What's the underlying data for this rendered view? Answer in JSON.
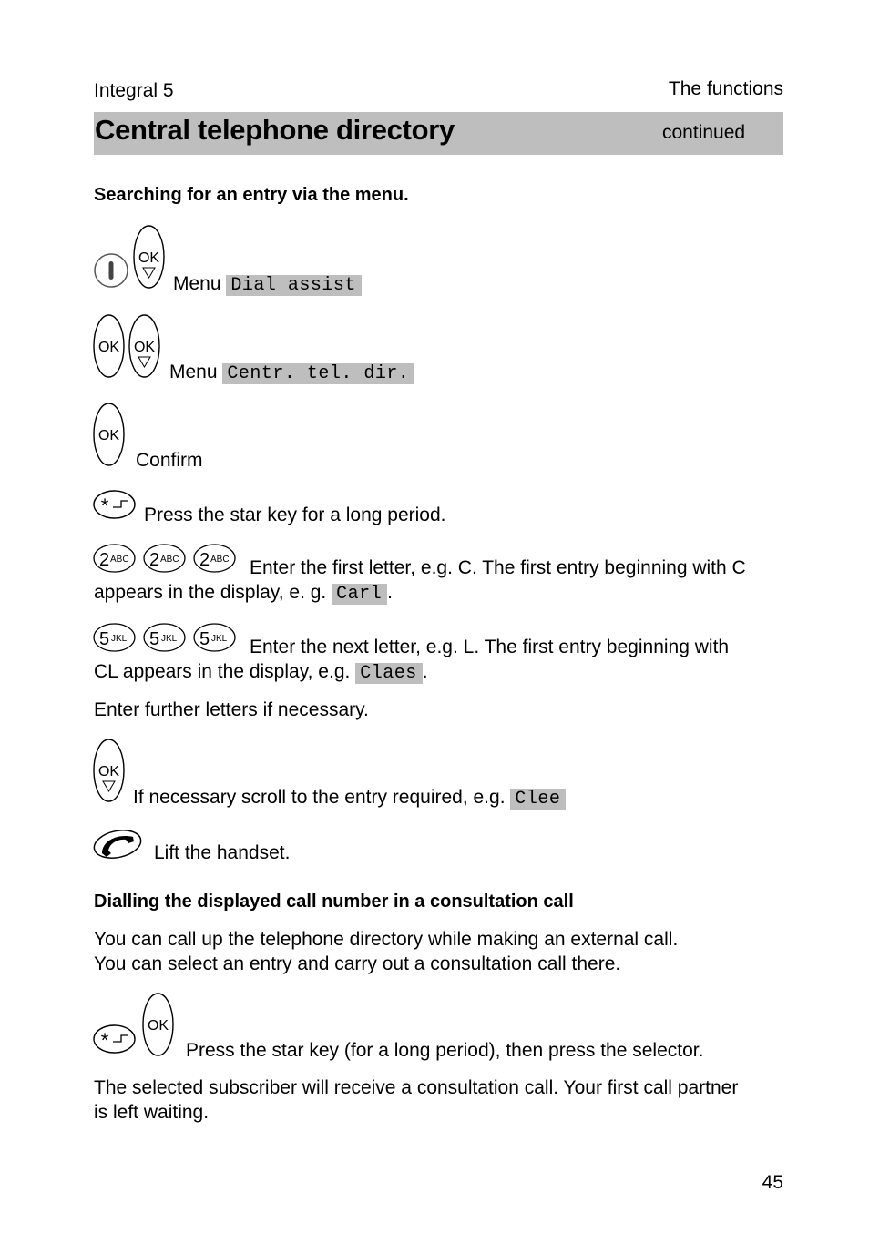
{
  "header": {
    "product": "Integral 5",
    "chapter": "The functions"
  },
  "title_bar": {
    "title": "Central telephone directory",
    "continued": "continued"
  },
  "section1": {
    "heading": "Searching for an entry via the menu.",
    "steps": [
      {
        "icons": [
          "handset-key-icon",
          "ok-scroll-key-icon"
        ],
        "text": "Menu",
        "display": "Dial assist"
      },
      {
        "icons": [
          "ok-key-icon",
          "ok-scroll-key-icon"
        ],
        "text": "Menu",
        "display": "Centr. tel. dir."
      },
      {
        "icons": [
          "ok-key-icon"
        ],
        "text": "Confirm"
      },
      {
        "icons": [
          "star-key-icon"
        ],
        "text": "Press the star key for a long period."
      },
      {
        "icons": [
          "key-2-abc-icon",
          "key-2-abc-icon",
          "key-2-abc-icon"
        ],
        "text": "Enter the first letter, e.g. C. The first entry beginning with C",
        "text2": "appears in the display, e. g.",
        "display": "Carl",
        "suffix": "."
      },
      {
        "icons": [
          "key-5-jkl-icon",
          "key-5-jkl-icon",
          "key-5-jkl-icon"
        ],
        "text": "Enter the next letter, e.g. L. The first entry beginning with",
        "text2": "CL appears in the display, e.g.",
        "display": "Claes",
        "suffix": "."
      }
    ],
    "note": "Enter further letters if necessary.",
    "steps2": [
      {
        "icons": [
          "ok-scroll-key-icon"
        ],
        "text": "If necessary scroll to the entry required, e.g.",
        "display": "Clee"
      },
      {
        "icons": [
          "handset-lift-icon"
        ],
        "text": "Lift the handset."
      }
    ]
  },
  "section2": {
    "heading": "Dialling the displayed call number in a consultation call",
    "intro_line1": "You can call up the telephone directory while making an external call.",
    "intro_line2": "You can select an entry and carry out a consultation call there.",
    "step": {
      "icons": [
        "star-key-icon",
        "ok-key-icon"
      ],
      "text": "Press the star key (for a long period), then press the selector."
    },
    "result_line1": "The selected subscriber will receive a consultation call. Your first call partner",
    "result_line2": "is left waiting."
  },
  "key_labels": {
    "ok": "OK",
    "two": "2",
    "abc": "ABC",
    "five": "5",
    "jkl": "JKL"
  },
  "footer": {
    "page_number": "45"
  }
}
